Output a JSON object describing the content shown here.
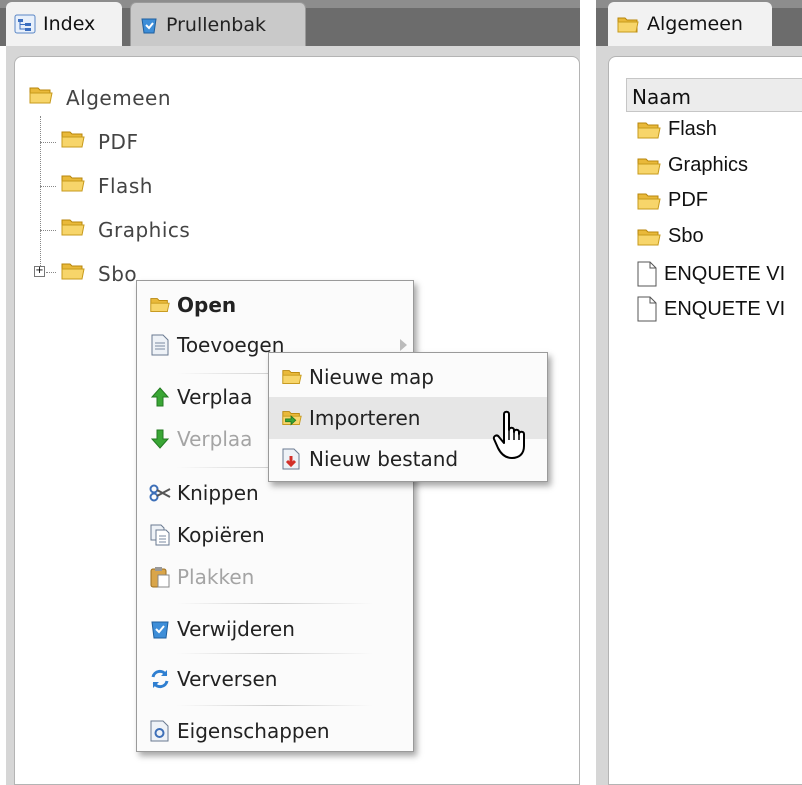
{
  "tabs_left": [
    {
      "label": "Index",
      "icon": "tree-icon"
    },
    {
      "label": "Prullenbak",
      "icon": "recycle-bin-icon"
    }
  ],
  "tab_right": {
    "label": "Algemeen",
    "icon": "folder-icon"
  },
  "tree": {
    "root": "Algemeen",
    "children": [
      "PDF",
      "Flash",
      "Graphics",
      "Sbo"
    ]
  },
  "file_list": {
    "column_header": "Naam",
    "rows": [
      {
        "name": "Flash",
        "icon": "folder-icon"
      },
      {
        "name": "Graphics",
        "icon": "folder-icon"
      },
      {
        "name": "PDF",
        "icon": "folder-icon"
      },
      {
        "name": "Sbo",
        "icon": "folder-icon"
      },
      {
        "name": "ENQUETE VI",
        "icon": "document-icon"
      },
      {
        "name": "ENQUETE VI",
        "icon": "document-icon"
      }
    ]
  },
  "context_menu": {
    "items": [
      {
        "label": "Open",
        "icon": "folder-icon"
      },
      {
        "label": "Toevoegen",
        "icon": "document-icon"
      },
      {
        "label": "Verplaa",
        "icon": "arrow-up-icon"
      },
      {
        "label": "Verplaa",
        "icon": "arrow-down-icon"
      },
      {
        "label": "Knippen",
        "icon": "scissors-icon"
      },
      {
        "label": "Kopiëren",
        "icon": "copy-icon"
      },
      {
        "label": "Plakken",
        "icon": "paste-icon"
      },
      {
        "label": "Verwijderen",
        "icon": "recycle-bin-icon"
      },
      {
        "label": "Verversen",
        "icon": "refresh-icon"
      },
      {
        "label": "Eigenschappen",
        "icon": "properties-icon"
      }
    ]
  },
  "submenu": {
    "items": [
      {
        "label": "Nieuwe map",
        "icon": "folder-icon"
      },
      {
        "label": "Importeren",
        "icon": "import-folder-icon"
      },
      {
        "label": "Nieuw bestand",
        "icon": "new-file-icon"
      }
    ]
  },
  "colors": {
    "folder": "#f2c94c",
    "frame": "#6c6c6c",
    "arrow_green": "#3aa635",
    "menu_hover": "#e6e6e6"
  }
}
